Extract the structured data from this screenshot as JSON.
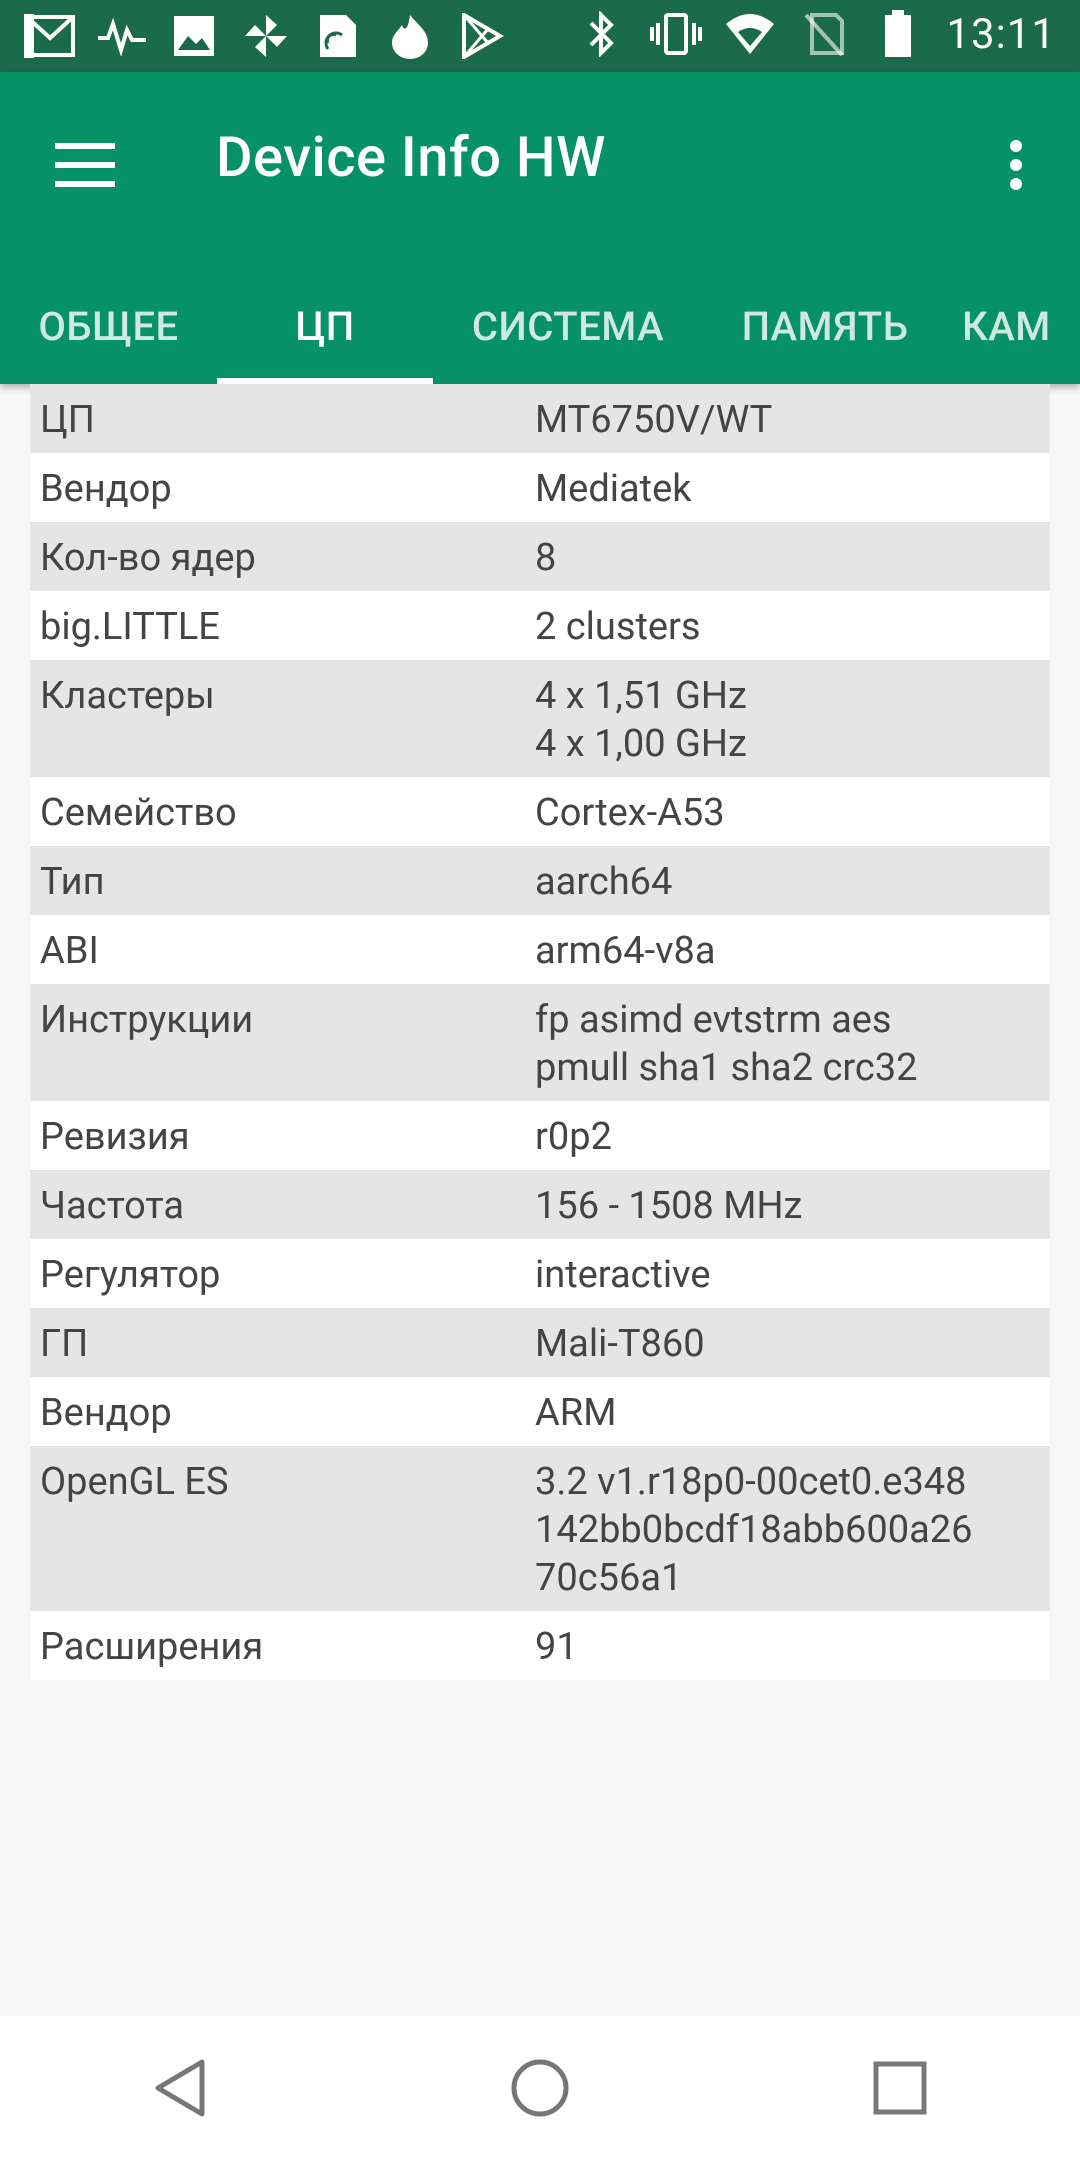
{
  "status_bar": {
    "time": "13:11",
    "left_icons": [
      "gmail-icon",
      "pulse-icon",
      "image-icon",
      "pinwheel-icon",
      "sim-card-icon",
      "fire-icon",
      "play-store-icon"
    ],
    "right_icons": [
      "bluetooth-icon",
      "vibrate-icon",
      "wifi-icon",
      "no-signal-icon",
      "battery-icon"
    ]
  },
  "app_bar": {
    "title": "Device Info HW",
    "tabs": [
      {
        "label": "ОБЩЕЕ"
      },
      {
        "label": "ЦП",
        "active": true
      },
      {
        "label": "СИСТЕМА"
      },
      {
        "label": "ПАМЯТЬ"
      },
      {
        "label": "КАМ"
      }
    ]
  },
  "rows": [
    {
      "key": "ЦП",
      "value": "MT6750V/WT"
    },
    {
      "key": "Вендор",
      "value": "Mediatek"
    },
    {
      "key": "Кол-во ядер",
      "value": "8"
    },
    {
      "key": "big.LITTLE",
      "value": "2 clusters"
    },
    {
      "key": "Кластеры",
      "value": "4 x 1,51 GHz\n4 x 1,00 GHz"
    },
    {
      "key": "Семейство",
      "value": "Cortex-A53"
    },
    {
      "key": "Тип",
      "value": "aarch64"
    },
    {
      "key": "ABI",
      "value": "arm64-v8a"
    },
    {
      "key": "Инструкции",
      "value": "fp asimd evtstrm aes\npmull sha1 sha2 crc32"
    },
    {
      "key": "Ревизия",
      "value": "r0p2"
    },
    {
      "key": "Частота",
      "value": "156 - 1508 MHz"
    },
    {
      "key": "Регулятор",
      "value": "interactive"
    },
    {
      "key": "ГП",
      "value": "Mali-T860"
    },
    {
      "key": "Вендор",
      "value": "ARM"
    },
    {
      "key": "OpenGL ES",
      "value": "3.2 v1.r18p0-00cet0.e348\n142bb0bcdf18abb600a26\n70c56a1"
    },
    {
      "key": "Расширения",
      "value": "91"
    }
  ],
  "colors": {
    "status_bar": "#1b6a4c",
    "app_bar": "#079167",
    "row_odd": "#e5e5e5",
    "row_even": "#ffffff"
  }
}
